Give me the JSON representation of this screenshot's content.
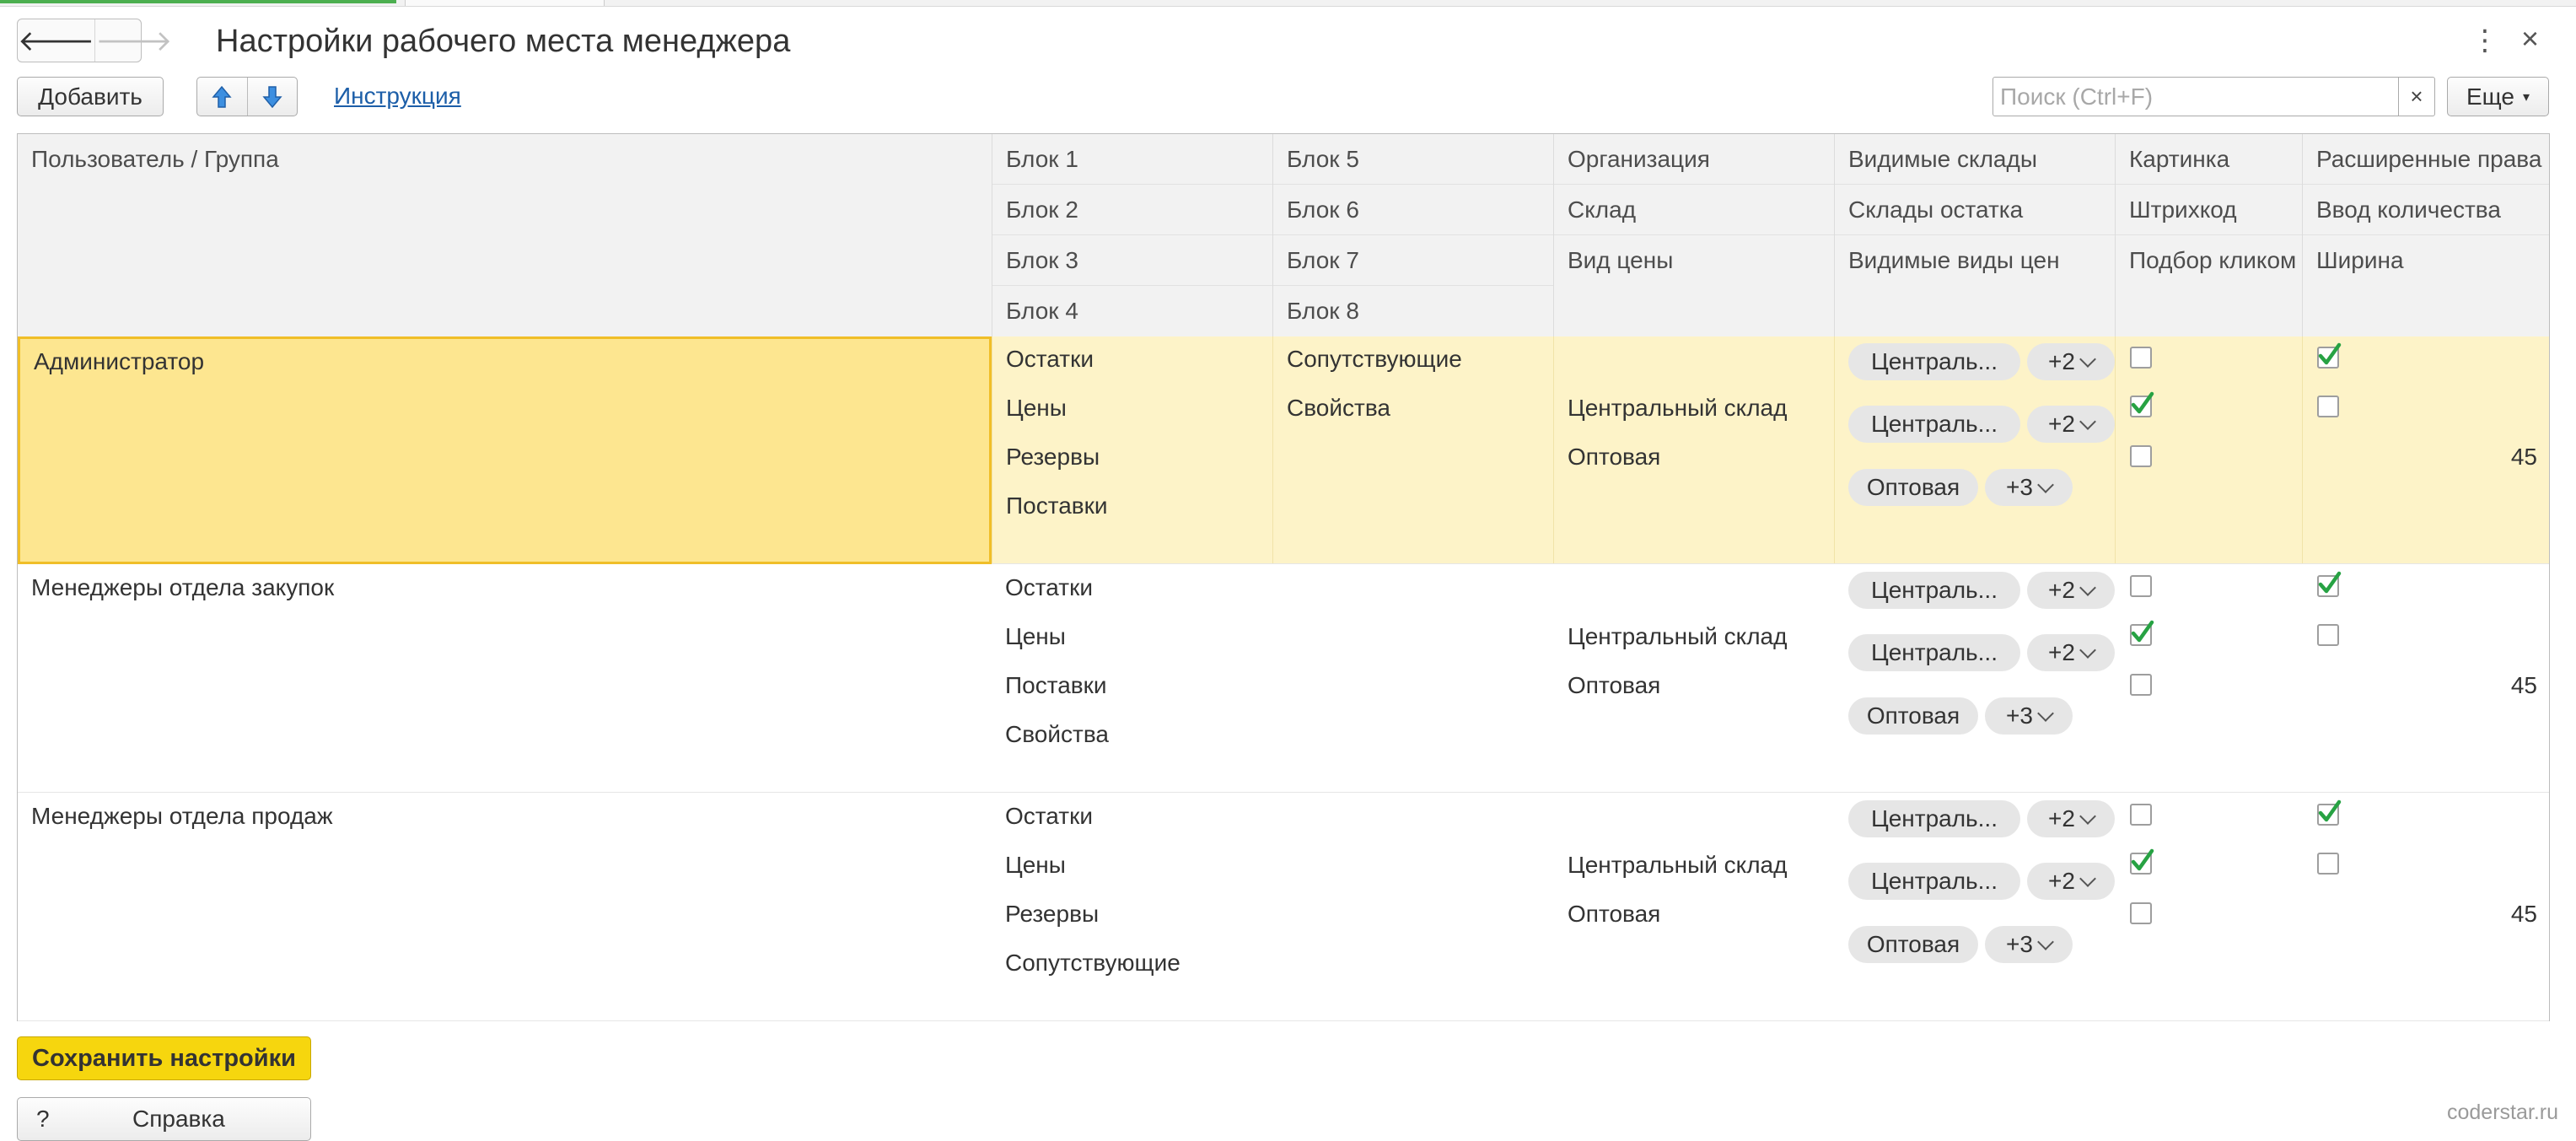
{
  "window": {
    "title": "Настройки рабочего места менеджера",
    "more_icon": "kebab-vertical-icon",
    "close_label": "×"
  },
  "nav": {
    "back_icon": "arrow-left-icon",
    "forward_icon": "arrow-right-icon",
    "back": "🡐",
    "forward": "🡒"
  },
  "toolbar": {
    "add_label": "Добавить",
    "up_icon": "blue-arrow-up-icon",
    "down_icon": "blue-arrow-down-icon",
    "instruction_link": "Инструкция",
    "search_placeholder": "Поиск (Ctrl+F)",
    "search_clear": "×",
    "more_label": "Еще",
    "accent_color": "#1c5ea8"
  },
  "table": {
    "headers": {
      "user": "Пользователь / Группа",
      "col1": [
        "Блок 1",
        "Блок 2",
        "Блок 3",
        "Блок 4"
      ],
      "col2": [
        "Блок 5",
        "Блок 6",
        "Блок 7",
        "Блок 8"
      ],
      "col3": [
        "Организация",
        "Склад",
        "Вид цены"
      ],
      "col4": [
        "Видимые склады",
        "Склады остатка",
        "Видимые виды цен"
      ],
      "col5": [
        "Картинка",
        "Штрихкод",
        "Подбор кликом"
      ],
      "col6": [
        "Расширенные права",
        "Ввод количества",
        "Ширина"
      ]
    },
    "rows": [
      {
        "user": "Администратор",
        "selected": true,
        "col1": [
          "Остатки",
          "Цены",
          "Резервы",
          "Поставки"
        ],
        "col2": [
          "Сопутствующие",
          "Свойства",
          "",
          ""
        ],
        "col3": [
          "",
          "Центральный склад",
          "Оптовая"
        ],
        "pills": [
          {
            "label": "Централь...",
            "more": "+2"
          },
          {
            "label": "Централь...",
            "more": "+2"
          },
          {
            "label": "Оптовая",
            "more": "+3"
          }
        ],
        "col5_checked": [
          false,
          true,
          false
        ],
        "col6_checked": [
          true,
          false
        ],
        "width": "45"
      },
      {
        "user": "Менеджеры отдела закупок",
        "selected": false,
        "col1": [
          "Остатки",
          "Цены",
          "Поставки",
          "Свойства"
        ],
        "col2": [
          "",
          "",
          "",
          ""
        ],
        "col3": [
          "",
          "Центральный склад",
          "Оптовая"
        ],
        "pills": [
          {
            "label": "Централь...",
            "more": "+2"
          },
          {
            "label": "Централь...",
            "more": "+2"
          },
          {
            "label": "Оптовая",
            "more": "+3"
          }
        ],
        "col5_checked": [
          false,
          true,
          false
        ],
        "col6_checked": [
          true,
          false
        ],
        "width": "45"
      },
      {
        "user": "Менеджеры отдела продаж",
        "selected": false,
        "col1": [
          "Остатки",
          "Цены",
          "Резервы",
          "Сопутствующие"
        ],
        "col2": [
          "",
          "",
          "",
          ""
        ],
        "col3": [
          "",
          "Центральный склад",
          "Оптовая"
        ],
        "pills": [
          {
            "label": "Централь...",
            "more": "+2"
          },
          {
            "label": "Централь...",
            "more": "+2"
          },
          {
            "label": "Оптовая",
            "more": "+3"
          }
        ],
        "col5_checked": [
          false,
          true,
          false
        ],
        "col6_checked": [
          true,
          false
        ],
        "width": "45"
      }
    ]
  },
  "footer": {
    "save_label": "Сохранить настройки",
    "help_q": "?",
    "help_label": "Справка",
    "save_color": "#f6d60e",
    "watermark": "coderstar.ru"
  }
}
